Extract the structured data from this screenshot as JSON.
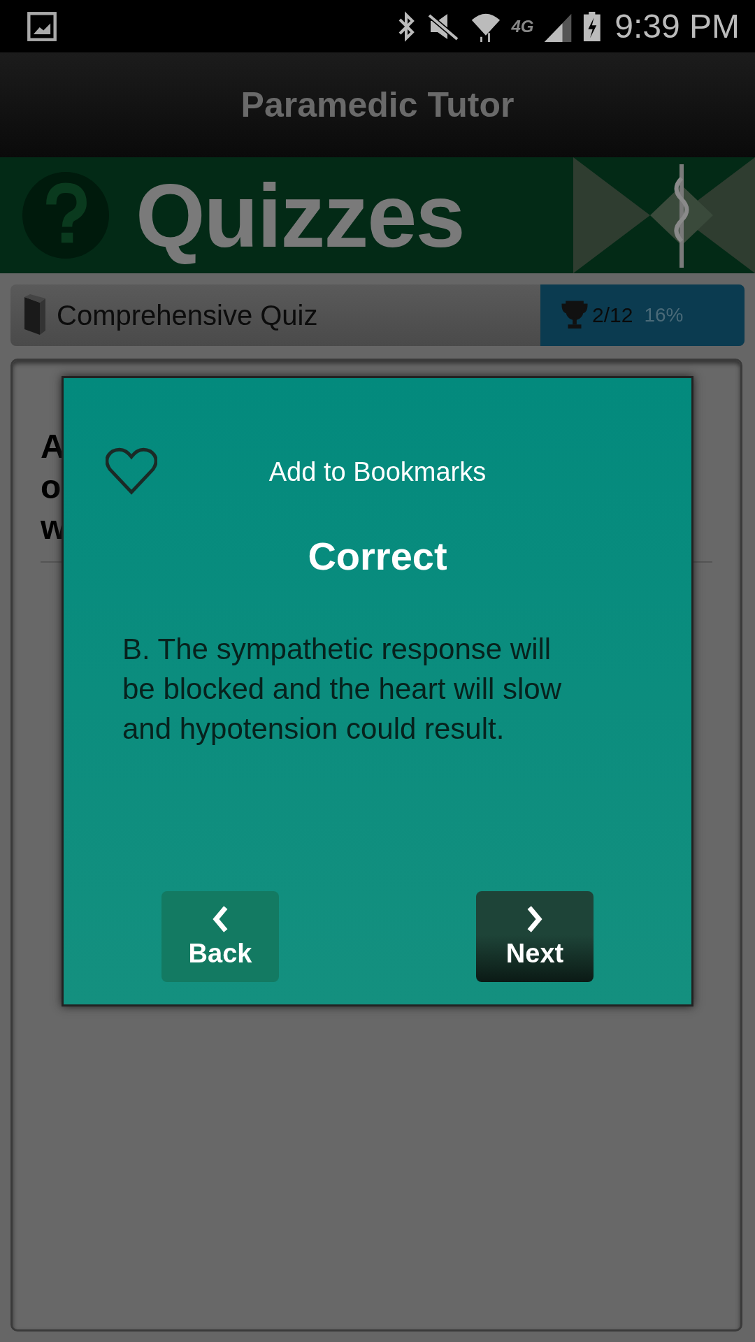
{
  "status_bar": {
    "time": "9:39 PM",
    "network": "4G"
  },
  "app_bar": {
    "title": "Paramedic Tutor"
  },
  "banner": {
    "title": "Quizzes"
  },
  "quiz_bar": {
    "name": "Comprehensive Quiz",
    "score": "2/12",
    "percent": "16%"
  },
  "question_fragments": [
    "A",
    "o",
    "w"
  ],
  "dialog": {
    "bookmark_label": "Add to Bookmarks",
    "bookmarked": false,
    "result": "Correct",
    "answer": "B. The sympathetic response will be blocked and the heart will slow and hypotension could result.",
    "buttons": [
      {
        "label": "Back",
        "kind": "back"
      },
      {
        "label": "Next",
        "kind": "next"
      }
    ]
  }
}
